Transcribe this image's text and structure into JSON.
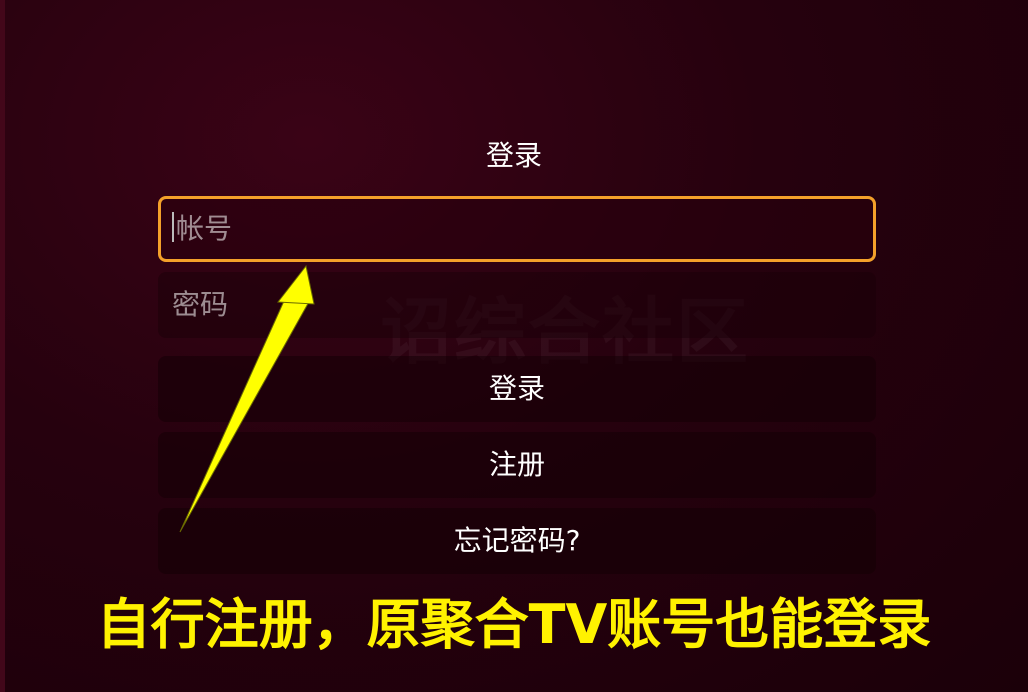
{
  "login": {
    "title": "登录",
    "account_placeholder": "帐号",
    "password_placeholder": "密码",
    "login_button": "登录",
    "register_button": "注册",
    "forgot_button": "忘记密码?"
  },
  "watermark": "诏综合社区",
  "caption": "自行注册，原聚合TV账号也能登录",
  "colors": {
    "focus_border": "#f4a12a",
    "caption": "#fff200",
    "arrow": "#ffff00",
    "background": "#26010e"
  }
}
